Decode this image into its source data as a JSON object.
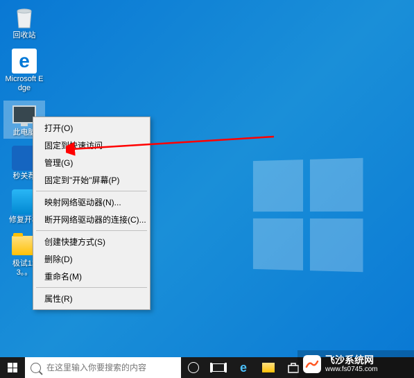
{
  "desktop": {
    "icons": [
      {
        "name": "recycle-bin",
        "label": "回收站"
      },
      {
        "name": "edge",
        "label": "Microsoft Edge"
      },
      {
        "name": "this-pc",
        "label": "此电脑"
      },
      {
        "name": "flash",
        "label": "秒关荐"
      },
      {
        "name": "repair",
        "label": "修复开机"
      },
      {
        "name": "folder-test",
        "label": "极试123。。"
      }
    ]
  },
  "context_menu": {
    "groups": [
      [
        {
          "label": "打开(O)"
        },
        {
          "label": "固定到快速访问"
        },
        {
          "label": "管理(G)"
        },
        {
          "label": "固定到\"开始\"屏幕(P)"
        }
      ],
      [
        {
          "label": "映射网络驱动器(N)..."
        },
        {
          "label": "断开网络驱动器的连接(C)..."
        }
      ],
      [
        {
          "label": "创建快捷方式(S)"
        },
        {
          "label": "删除(D)"
        },
        {
          "label": "重命名(M)"
        }
      ],
      [
        {
          "label": "属性(R)"
        }
      ]
    ]
  },
  "taskbar": {
    "search_placeholder": "在这里输入你要搜索的内容"
  },
  "watermark": {
    "title": "飞沙系统网",
    "url": "www.fs0745.com"
  },
  "colors": {
    "desktop_bg": "#0978d4",
    "taskbar_bg": "#1a1a1a",
    "menu_bg": "#f0f0f0",
    "arrow": "#ff0000"
  }
}
